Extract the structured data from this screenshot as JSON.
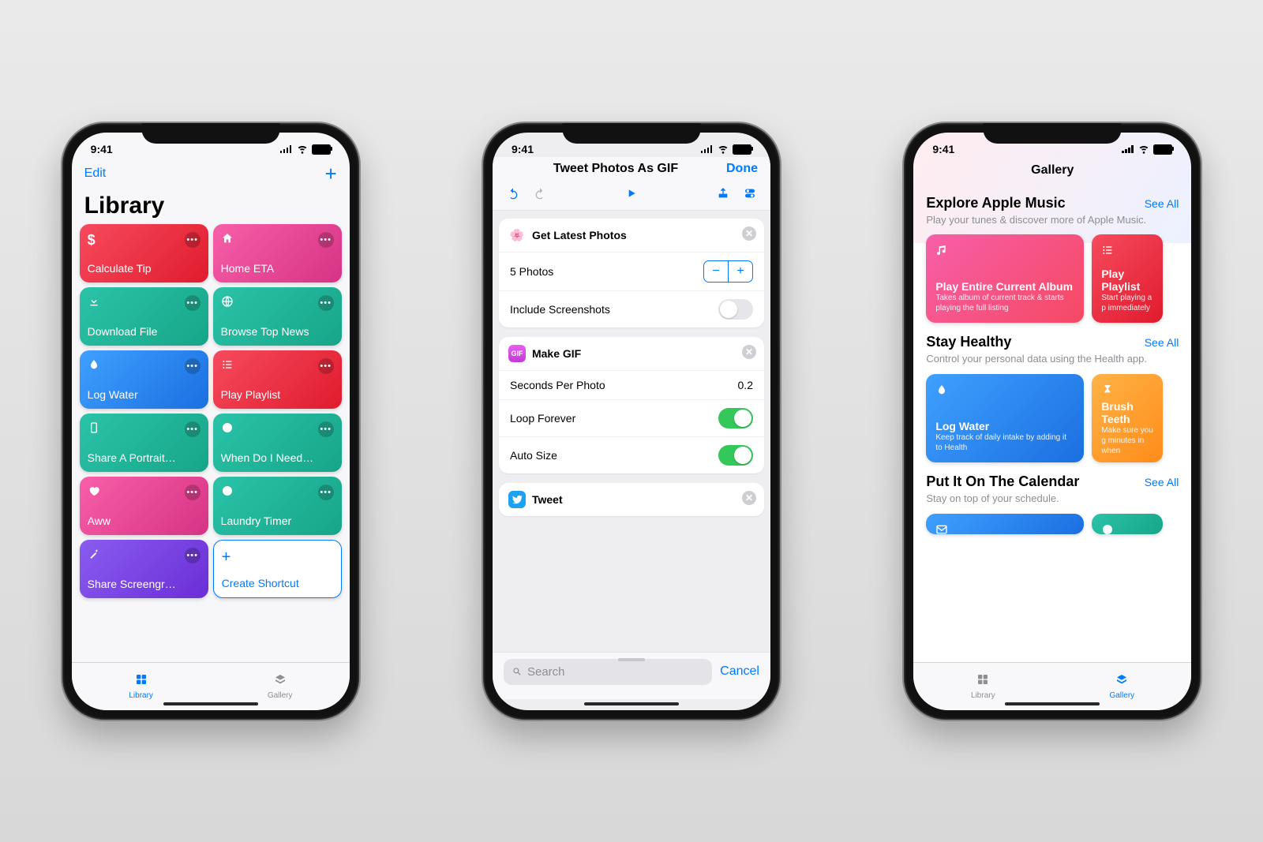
{
  "status": {
    "time": "9:41"
  },
  "library": {
    "edit": "Edit",
    "title": "Library",
    "tiles": [
      {
        "id": "calculate-tip",
        "icon": "$",
        "label": "Calculate Tip",
        "grad": [
          "#f64b5d",
          "#e01b2e"
        ]
      },
      {
        "id": "home-eta",
        "icon": "home",
        "label": "Home ETA",
        "grad": [
          "#f85fa9",
          "#d63384"
        ]
      },
      {
        "id": "download-file",
        "icon": "download",
        "label": "Download File",
        "grad": [
          "#2bc3a8",
          "#17a589"
        ]
      },
      {
        "id": "browse-top-news",
        "icon": "globe",
        "label": "Browse Top News",
        "grad": [
          "#2bc3a8",
          "#17a589"
        ]
      },
      {
        "id": "log-water",
        "icon": "drop",
        "label": "Log Water",
        "grad": [
          "#3fa0ff",
          "#1b6fe0"
        ]
      },
      {
        "id": "play-playlist",
        "icon": "list",
        "label": "Play Playlist",
        "grad": [
          "#f64b5d",
          "#e01b2e"
        ]
      },
      {
        "id": "share-portrait",
        "icon": "screen",
        "label": "Share A Portrait…",
        "grad": [
          "#2bc3a8",
          "#17a589"
        ]
      },
      {
        "id": "when-do-i-need",
        "icon": "clock",
        "label": "When Do I Need…",
        "grad": [
          "#2bc3a8",
          "#17a589"
        ]
      },
      {
        "id": "aww",
        "icon": "heart",
        "label": "Aww",
        "grad": [
          "#f85fa9",
          "#d63384"
        ]
      },
      {
        "id": "laundry-timer",
        "icon": "clock",
        "label": "Laundry Timer",
        "grad": [
          "#2bc3a8",
          "#17a589"
        ]
      },
      {
        "id": "share-screengrab",
        "icon": "wand",
        "label": "Share Screengr…",
        "grad": [
          "#8a5cf0",
          "#6a2ed6"
        ]
      }
    ],
    "create": "Create Shortcut",
    "tab_library": "Library",
    "tab_gallery": "Gallery"
  },
  "editor": {
    "title": "Tweet Photos As GIF",
    "done": "Done",
    "actions": {
      "getPhotos": {
        "title": "Get Latest Photos",
        "count_label": "5 Photos",
        "screenshots_label": "Include Screenshots"
      },
      "makeGif": {
        "title": "Make GIF",
        "seconds_label": "Seconds Per Photo",
        "seconds_val": "0.2",
        "loop_label": "Loop Forever",
        "auto_label": "Auto Size"
      },
      "tweet": {
        "title": "Tweet"
      }
    },
    "search_placeholder": "Search",
    "cancel": "Cancel"
  },
  "gallery": {
    "title": "Gallery",
    "sections": [
      {
        "id": "explore-apple-music",
        "title": "Explore Apple Music",
        "seeall": "See All",
        "desc": "Play your tunes & discover more of Apple Music.",
        "cards": [
          {
            "id": "play-entire-album",
            "icon": "music",
            "title": "Play Entire Current Album",
            "sub": "Takes album of current track & starts playing the full listing",
            "grad": [
              "#f85fa9",
              "#f54963"
            ]
          },
          {
            "id": "play-playlist",
            "icon": "list",
            "title": "Play Playlist",
            "sub": "Start playing a p\nimmediately",
            "grad": [
              "#f64b5d",
              "#e01b2e"
            ]
          }
        ]
      },
      {
        "id": "stay-healthy",
        "title": "Stay Healthy",
        "seeall": "See All",
        "desc": "Control your personal data using the Health app.",
        "cards": [
          {
            "id": "log-water",
            "icon": "drop",
            "title": "Log Water",
            "sub": "Keep track of daily intake by adding it to Health",
            "grad": [
              "#3fa0ff",
              "#1b6fe0"
            ]
          },
          {
            "id": "brush-teeth",
            "icon": "hourglass",
            "title": "Brush Teeth",
            "sub": "Make sure you g\nminutes in when",
            "grad": [
              "#ffb347",
              "#ff8c1a"
            ]
          }
        ]
      },
      {
        "id": "put-it-on-calendar",
        "title": "Put It On The Calendar",
        "seeall": "See All",
        "desc": "Stay on top of your schedule.",
        "cards": [
          {
            "id": "calendar-card-1",
            "icon": "mail",
            "title": "",
            "sub": "",
            "grad": [
              "#3fa0ff",
              "#1b6fe0"
            ]
          },
          {
            "id": "calendar-card-2",
            "icon": "clock",
            "title": "",
            "sub": "",
            "grad": [
              "#2bc3a8",
              "#17a589"
            ]
          }
        ]
      }
    ]
  }
}
